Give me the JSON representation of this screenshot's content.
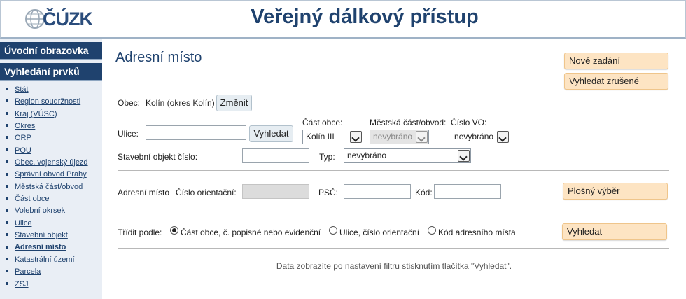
{
  "header": {
    "logo_text": "ČÚZK",
    "title": "Veřejný dálkový přístup"
  },
  "sidebar": {
    "home_label": "Úvodní obrazovka",
    "search_label": "Vyhledání prvků",
    "items": [
      {
        "label": "Stát"
      },
      {
        "label": "Region soudržnosti"
      },
      {
        "label": "Kraj (VÚSC)"
      },
      {
        "label": "Okres"
      },
      {
        "label": "ORP"
      },
      {
        "label": "POU"
      },
      {
        "label": "Obec, vojenský újezd"
      },
      {
        "label": "Správní obvod Prahy"
      },
      {
        "label": "Městská část/obvod"
      },
      {
        "label": "Část obce"
      },
      {
        "label": "Volební okrsek"
      },
      {
        "label": "Ulice"
      },
      {
        "label": "Stavební objekt"
      },
      {
        "label": "Adresní místo",
        "active": true
      },
      {
        "label": "Katastrální území"
      },
      {
        "label": "Parcela"
      },
      {
        "label": "ZSJ"
      }
    ]
  },
  "main": {
    "title": "Adresní místo",
    "new_entry_button": "Nové zadání",
    "search_cancelled_button": "Vyhledat zrušené",
    "obec_label": "Obec:",
    "obec_value": "Kolín (okres Kolín)",
    "change_button": "Změnit",
    "ulice_label": "Ulice:",
    "ulice_value": "",
    "find_button": "Vyhledat",
    "cast_obce_label": "Část obce:",
    "cast_obce_value": "Kolín III",
    "mestska_cast_label": "Městská část/obvod:",
    "mestska_cast_value": "nevybráno",
    "cislo_vo_label": "Číslo VO:",
    "cislo_vo_value": "nevybráno",
    "stavebni_objekt_label": "Stavební objekt číslo:",
    "typ_label": "Typ:",
    "typ_value": "nevybráno",
    "adresni_misto_label": "Adresní místo",
    "cislo_orientacni_label": "Číslo orientační:",
    "psc_label": "PSČ:",
    "kod_label": "Kód:",
    "area_select_button": "Plošný výběr",
    "sort_label": "Třídit podle:",
    "sort_options": [
      {
        "label": "Část obce, č. popisné nebo evidenční",
        "selected": true
      },
      {
        "label": "Ulice, číslo orientační",
        "selected": false
      },
      {
        "label": "Kód adresního místa",
        "selected": false
      }
    ],
    "search_button": "Vyhledat",
    "note": "Data zobrazíte po nastavení filtru stisknutím tlačítka \"Vyhledat\"."
  },
  "colors": {
    "brand": "#1f426e",
    "orange_button": "#fde4c3",
    "sidebar_bg": "#e9eef5"
  }
}
